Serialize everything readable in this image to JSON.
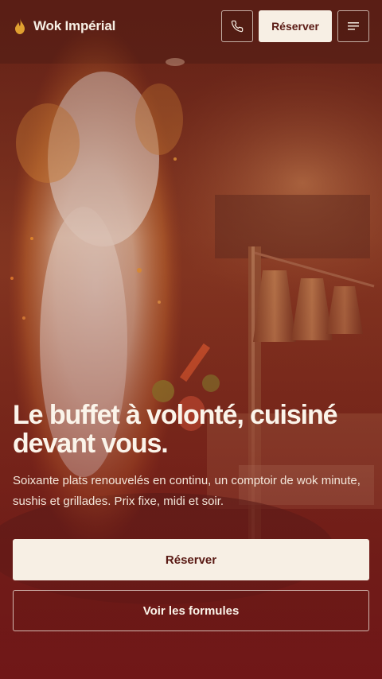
{
  "header": {
    "brand_name": "Wok Impérial",
    "brand_icon": "flame-icon",
    "phone_icon": "phone-icon",
    "reserve_label": "Réserver",
    "menu_icon": "menu-icon"
  },
  "hero": {
    "headline": "Le buffet à volonté, cuisiné devant vous.",
    "lead": "Soixante plats renouvelés en continu, un comptoir de wok minute, sushis et grillades. Prix fixe, midi et soir.",
    "primary_cta": "Réserver",
    "secondary_cta": "Voir les formules"
  },
  "colors": {
    "accent": "#f7efe4",
    "brand_dark": "#5a1a14",
    "flame": "#e0a030"
  }
}
